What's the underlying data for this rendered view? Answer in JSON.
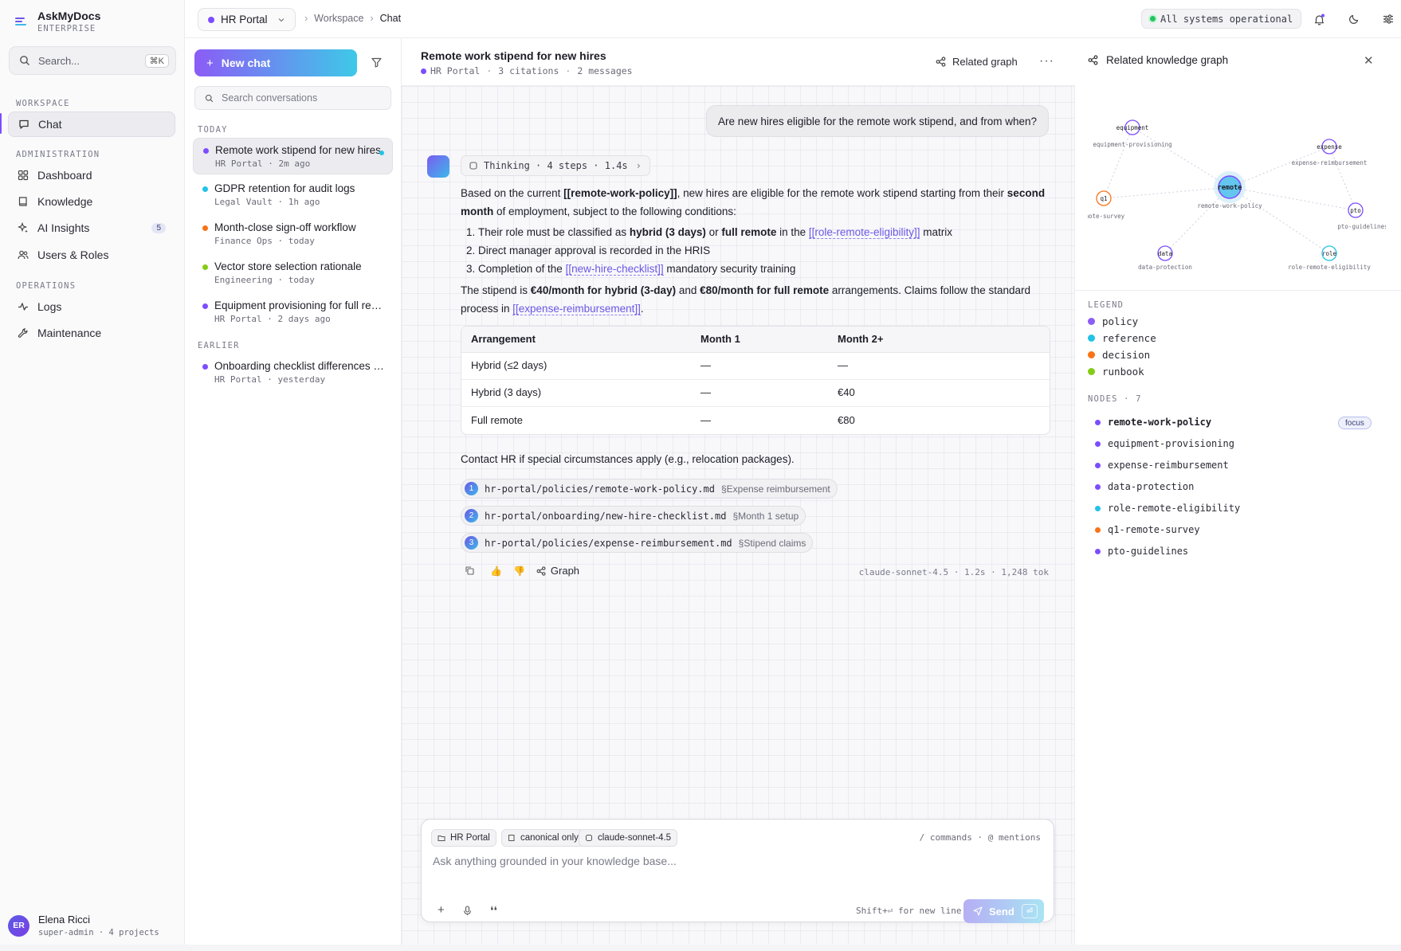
{
  "brand": {
    "name": "AskMyDocs",
    "subtitle": "ENTERPRISE"
  },
  "sidebar": {
    "search_placeholder": "Search...",
    "search_shortcut": "⌘K",
    "sections": {
      "workspace": "WORKSPACE",
      "administration": "ADMINISTRATION",
      "operations": "OPERATIONS"
    },
    "items": [
      {
        "label": "Chat",
        "icon": "chat-bubble-icon",
        "active": true
      },
      {
        "label": "Dashboard",
        "icon": "grid-icon"
      },
      {
        "label": "Knowledge",
        "icon": "book-icon"
      },
      {
        "label": "AI Insights",
        "icon": "sparkle-icon",
        "badge": "5"
      },
      {
        "label": "Users & Roles",
        "icon": "users-icon"
      },
      {
        "label": "Logs",
        "icon": "activity-icon"
      },
      {
        "label": "Maintenance",
        "icon": "wrench-icon"
      }
    ],
    "user": {
      "initials": "ER",
      "name": "Elena Ricci",
      "role": "super-admin",
      "projects": "4 projects"
    }
  },
  "topbar": {
    "project": "HR Portal",
    "project_color": "#7c4dff",
    "breadcrumb": [
      "Workspace",
      "Chat"
    ],
    "status": "All systems operational",
    "status_color": "#22c55e"
  },
  "conversations": {
    "new_chat": "New chat",
    "search_placeholder": "Search conversations",
    "groups": {
      "today": "TODAY",
      "earlier": "EARLIER"
    },
    "items": [
      {
        "title": "Remote work stipend for new hires",
        "project": "HR Portal",
        "time": "2m ago",
        "color": "#7c4dff",
        "active": true,
        "unread": true
      },
      {
        "title": "GDPR retention for audit logs",
        "project": "Legal Vault",
        "time": "1h ago",
        "color": "#22c3e6"
      },
      {
        "title": "Month-close sign-off workflow",
        "project": "Finance Ops",
        "time": "today",
        "color": "#f97316"
      },
      {
        "title": "Vector store selection rationale",
        "project": "Engineering",
        "time": "today",
        "color": "#84cc16"
      },
      {
        "title": "Equipment provisioning for full remote",
        "project": "HR Portal",
        "time": "2 days ago",
        "color": "#7c4dff"
      },
      {
        "title": "Onboarding checklist differences EU vs US",
        "project": "HR Portal",
        "time": "yesterday",
        "color": "#7c4dff"
      }
    ]
  },
  "chat": {
    "title": "Remote work stipend for new hires",
    "project": "HR Portal",
    "citations": "3 citations",
    "messages": "2 messages",
    "related_graph": "Related graph",
    "more": "···",
    "user_message": "Are new hires eligible for the remote work stipend, and from when?",
    "thinking": {
      "label": "Thinking",
      "steps": "4 steps",
      "time": "1.4s"
    },
    "answer": {
      "p1_a": "Based on the current ",
      "p1_link": "[[remote-work-policy]]",
      "p1_b": ", new hires are eligible for the remote work stipend starting from their ",
      "p1_bold": "second month",
      "p1_c": " of employment, subject to the following conditions:",
      "li1_a": "Their role must be classified as ",
      "li1_b1": "hybrid (3 days)",
      "li1_or": " or ",
      "li1_b2": "full remote",
      "li1_c": " in the ",
      "li1_link": "[[role-remote-eligibility]]",
      "li1_d": " matrix",
      "li2": "Direct manager approval is recorded in the HRIS",
      "li3_a": "Completion of the ",
      "li3_link": "[[new-hire-checklist]]",
      "li3_b": " mandatory security training",
      "p2_a": "The stipend is ",
      "p2_b1": "€40/month for hybrid (3-day)",
      "p2_and": " and ",
      "p2_b2": "€80/month for full remote",
      "p2_c": " arrangements. Claims follow the standard process in ",
      "p2_link": "[[expense-reimbursement]]",
      "p2_d": ".",
      "table": {
        "headers": [
          "Arrangement",
          "Month 1",
          "Month 2+"
        ],
        "rows": [
          [
            "Hybrid (≤2 days)",
            "—",
            "—"
          ],
          [
            "Hybrid (3 days)",
            "—",
            "€40"
          ],
          [
            "Full remote",
            "—",
            "€80"
          ]
        ]
      },
      "contact": "Contact HR if special circumstances apply (e.g., relocation packages)."
    },
    "citation_list": [
      {
        "n": "1",
        "path": "hr-portal/policies/remote-work-policy.md",
        "section": "§Expense reimbursement"
      },
      {
        "n": "2",
        "path": "hr-portal/onboarding/new-hire-checklist.md",
        "section": "§Month 1 setup"
      },
      {
        "n": "3",
        "path": "hr-portal/policies/expense-reimbursement.md",
        "section": "§Stipend claims"
      }
    ],
    "graph_action": "Graph",
    "run_meta": "claude-sonnet-4.5 · 1.2s · 1,248 tok"
  },
  "composer": {
    "chips": [
      "HR Portal",
      "canonical only",
      "claude-sonnet-4.5"
    ],
    "hints": "/ commands · @ mentions",
    "placeholder": "Ask anything grounded in your knowledge base...",
    "shift_hint": "Shift+⏎ for new line",
    "send": "Send",
    "send_key": "⏎"
  },
  "graph_panel": {
    "title": "Related knowledge graph",
    "legend_label": "LEGEND",
    "legend": [
      {
        "label": "policy",
        "color": "#8b5cf6"
      },
      {
        "label": "reference",
        "color": "#22c3e6"
      },
      {
        "label": "decision",
        "color": "#f97316"
      },
      {
        "label": "runbook",
        "color": "#84cc16"
      }
    ],
    "nodes_label": "NODES · 7",
    "focus": "focus",
    "nodes": [
      {
        "name": "remote-work-policy",
        "color": "#7c4dff",
        "short": "remote"
      },
      {
        "name": "equipment-provisioning",
        "color": "#7c4dff",
        "short": "equipment"
      },
      {
        "name": "expense-reimbursement",
        "color": "#7c4dff",
        "short": "expense"
      },
      {
        "name": "data-protection",
        "color": "#7c4dff",
        "short": "data"
      },
      {
        "name": "role-remote-eligibility",
        "color": "#22c3e6",
        "short": "role"
      },
      {
        "name": "q1-remote-survey",
        "color": "#f97316",
        "short": "q1"
      },
      {
        "name": "pto-guidelines",
        "color": "#7c4dff",
        "short": "pto"
      }
    ]
  }
}
